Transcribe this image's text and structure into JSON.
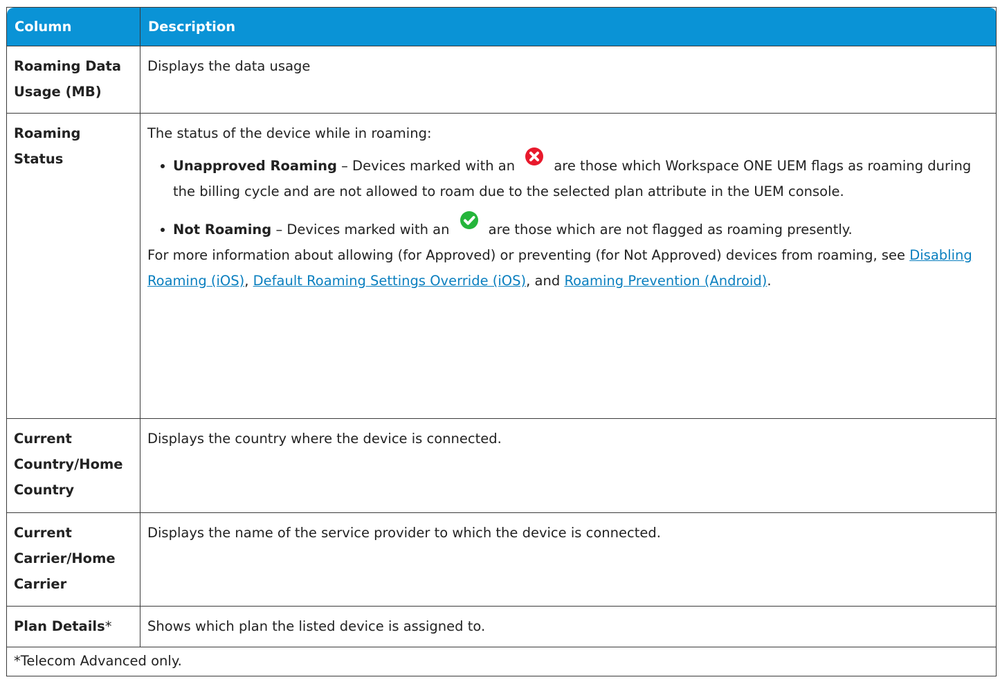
{
  "table": {
    "headers": {
      "column": "Column",
      "description": "Description"
    },
    "rows": [
      {
        "name": "Roaming Data Usage (MB)",
        "description": "Displays the data usage"
      },
      {
        "name": "Roaming Status",
        "intro": "The status of the device while in roaming:",
        "bullets": [
          {
            "term": "Unapproved Roaming",
            "before_icon": " – Devices marked with an ",
            "icon": "red-x-circle-icon",
            "after_icon": "are those which Workspace ONE UEM flags as roaming during the billing cycle and are not allowed to roam due to the selected plan attribute in the UEM console."
          },
          {
            "term": "Not Roaming",
            "before_icon": " – Devices marked with an ",
            "icon": "green-check-circle-icon",
            "after_icon": "are those which are not flagged as roaming presently."
          }
        ],
        "more_info": {
          "lead": "For more information about allowing (for Approved) or preventing (for Not Approved) devices from roaming, see ",
          "link1": "Disabling Roaming (iOS)",
          "sep1": ", ",
          "link2": "Default Roaming Settings Override (iOS)",
          "sep2": ", and ",
          "link3": "Roaming Prevention (Android)",
          "end": "."
        }
      },
      {
        "name": "Current Country/Home Country",
        "description": "Displays the country where the device is connected."
      },
      {
        "name": "Current Carrier/Home Carrier",
        "description": "Displays the name of the service provider to which the device is connected."
      },
      {
        "name": "Plan Details",
        "name_suffix": "*",
        "description": "Shows which plan the listed device is assigned to."
      }
    ],
    "footnote": "*Telecom Advanced only."
  },
  "colors": {
    "header_bg": "#0a93d6",
    "link": "#0a7fbf",
    "error_icon": "#e8192c",
    "success_icon": "#25b53b"
  }
}
